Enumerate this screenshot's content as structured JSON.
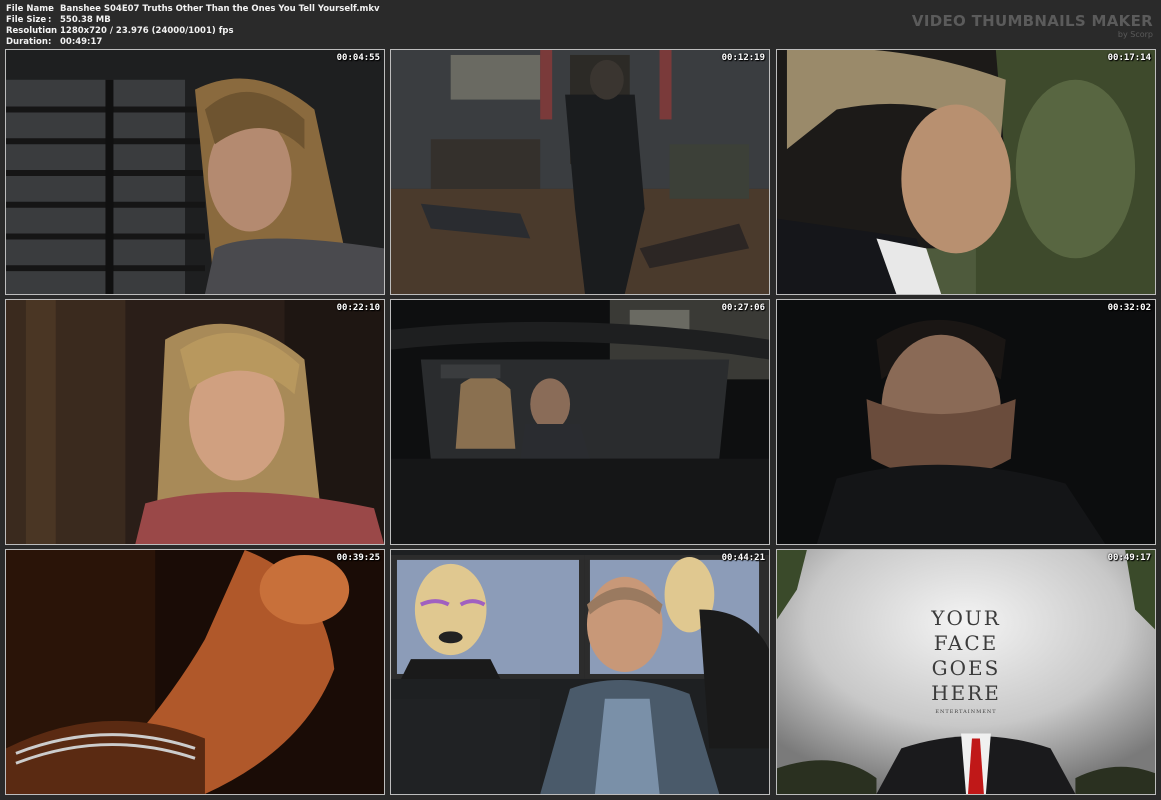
{
  "file_info": {
    "rows": [
      {
        "key": "File Name",
        "value": "Banshee S04E07 Truths Other Than the Ones You Tell Yourself.mkv"
      },
      {
        "key": "File Size",
        "value": "550.38 MB"
      },
      {
        "key": "Resolution",
        "value": "1280x720 / 23.976 (24000/1001) fps"
      },
      {
        "key": "Duration",
        "value": "00:49:17"
      }
    ],
    "separator": ":"
  },
  "brand": {
    "title": "VIDEO THUMBNAILS MAKER",
    "subtitle": "by Scorp"
  },
  "thumbnails": [
    {
      "timestamp": "00:04:55",
      "scene": "woman-at-window"
    },
    {
      "timestamp": "00:12:19",
      "scene": "man-in-office"
    },
    {
      "timestamp": "00:17:14",
      "scene": "grey-haired-man"
    },
    {
      "timestamp": "00:22:10",
      "scene": "blonde-woman"
    },
    {
      "timestamp": "00:27:06",
      "scene": "couple-in-car"
    },
    {
      "timestamp": "00:32:02",
      "scene": "smiling-man"
    },
    {
      "timestamp": "00:39:25",
      "scene": "orange-lit-figure"
    },
    {
      "timestamp": "00:44:21",
      "scene": "man-at-monitors"
    },
    {
      "timestamp": "00:49:17",
      "scene": "poster"
    }
  ],
  "poster": {
    "lines": [
      "YOUR",
      "FACE",
      "GOES",
      "HERE"
    ],
    "caption": "ENTERTAINMENT"
  }
}
